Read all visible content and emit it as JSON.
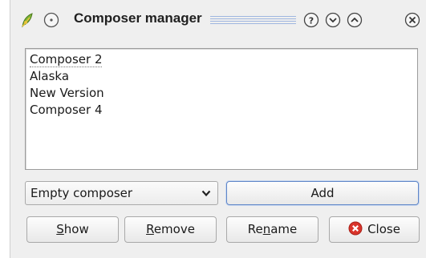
{
  "window": {
    "title": "Composer manager",
    "icons": {
      "app": "qgis-leaf-icon",
      "pin": "pin-icon",
      "help": "help-icon",
      "minimize": "chevron-down-icon",
      "maximize": "chevron-up-icon",
      "close": "close-icon"
    },
    "title_accent": "#9fb6e0"
  },
  "composer_list": {
    "items": [
      "Composer 2",
      "Alaska",
      "New Version",
      "Composer 4"
    ]
  },
  "template_combo": {
    "selected": "Empty composer"
  },
  "buttons": {
    "add": "Add",
    "show_mnemonic": "S",
    "show_rest": "how",
    "remove_mnemonic": "R",
    "remove_rest": "emove",
    "rename_pre": "Re",
    "rename_mnemonic": "n",
    "rename_post": "ame",
    "close": "Close"
  },
  "colors": {
    "close_button_accent": "#d9342b",
    "focus_border": "#5f86c8"
  }
}
